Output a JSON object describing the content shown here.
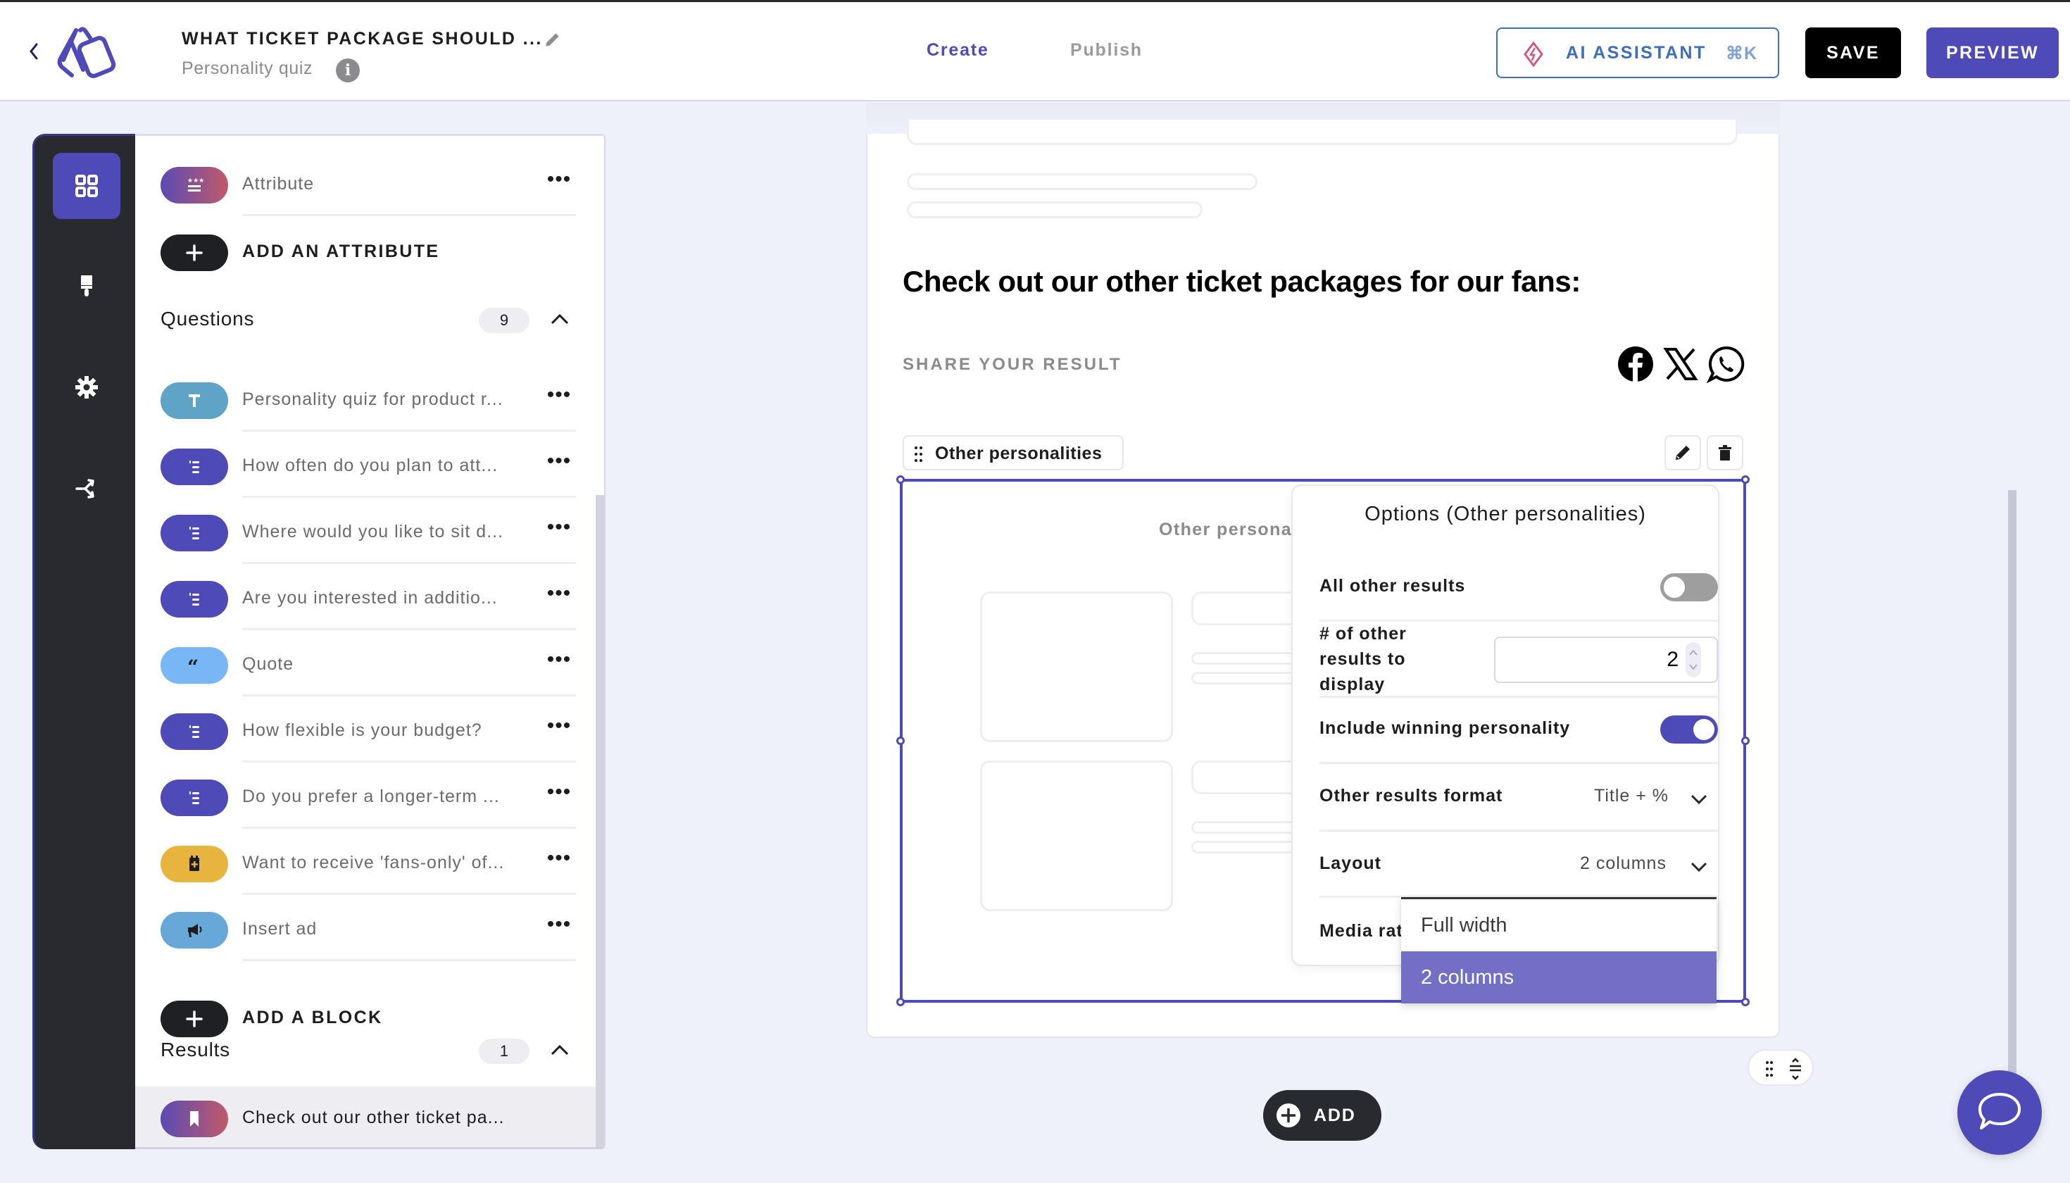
{
  "header": {
    "title": "WHAT TICKET PACKAGE SHOULD ...",
    "subtitle": "Personality quiz",
    "tabs": [
      {
        "label": "Create",
        "active": true
      },
      {
        "label": "Publish",
        "active": false
      }
    ],
    "ai_assistant_label": "AI ASSISTANT",
    "ai_assistant_shortcut": "⌘K",
    "save_label": "SAVE",
    "preview_label": "PREVIEW"
  },
  "rail": {
    "items": [
      {
        "icon": "grid-icon",
        "active": true
      },
      {
        "icon": "paint-brush-icon",
        "active": false
      },
      {
        "icon": "gear-icon",
        "active": false
      },
      {
        "icon": "branch-icon",
        "active": false
      }
    ]
  },
  "panel": {
    "attribute": {
      "label": "Attribute",
      "icon": "attribute-icon"
    },
    "add_attribute_label": "ADD AN ATTRIBUTE",
    "questions": {
      "heading": "Questions",
      "count": "9",
      "items": [
        {
          "label": "Personality quiz for product r...",
          "icon": "text-icon",
          "color": "#5fa3c6"
        },
        {
          "label": "How often do you plan to att...",
          "icon": "list-icon",
          "color": "#4e4bb8"
        },
        {
          "label": "Where would you like to sit d...",
          "icon": "list-icon",
          "color": "#4e4bb8"
        },
        {
          "label": "Are you interested in additio...",
          "icon": "list-icon",
          "color": "#4e4bb8"
        },
        {
          "label": "Quote",
          "icon": "quote-icon",
          "color": "#79b6f5"
        },
        {
          "label": "How flexible is your budget?",
          "icon": "list-icon",
          "color": "#4e4bb8"
        },
        {
          "label": "Do you prefer a longer-term ...",
          "icon": "list-icon",
          "color": "#4e4bb8"
        },
        {
          "label": "Want to receive 'fans-only' of...",
          "icon": "form-icon",
          "color": "#e7b53e"
        },
        {
          "label": "Insert ad",
          "icon": "megaphone-icon",
          "color": "#67a8d9"
        }
      ]
    },
    "add_block_label": "ADD A BLOCK",
    "results": {
      "heading": "Results",
      "count": "1",
      "items": [
        {
          "label": "Check out our other ticket pa...",
          "icon": "bookmark-icon"
        }
      ]
    }
  },
  "canvas": {
    "result_heading": "Check out our other ticket packages for our fans:",
    "share_label": "SHARE YOUR RESULT",
    "social": [
      "facebook-icon",
      "x-icon",
      "whatsapp-icon"
    ],
    "block_tag_label": "Other personalities",
    "inner_title": "Other personal",
    "add_label": "ADD"
  },
  "options": {
    "title": "Options (Other personalities)",
    "all_other_results": {
      "label": "All other results",
      "on": false
    },
    "num_results": {
      "label": "# of other results to display",
      "label_lines": [
        "# of other",
        "results to",
        "display"
      ],
      "value": "2"
    },
    "include_winning": {
      "label": "Include winning personality",
      "on": true
    },
    "format": {
      "label": "Other results format",
      "value": "Title + %"
    },
    "layout": {
      "label": "Layout",
      "value": "2 columns"
    },
    "media_ratio": {
      "label": "Media rat"
    },
    "layout_dropdown": {
      "options": [
        "Full width",
        "2 columns"
      ],
      "selected": "2 columns"
    }
  },
  "colors": {
    "accent": "#4e4bb8",
    "rail_bg": "#282a30",
    "page_bg": "#eef0fa",
    "ai_blue": "#3c6fb8",
    "dropdown_selected": "#736fc6"
  }
}
